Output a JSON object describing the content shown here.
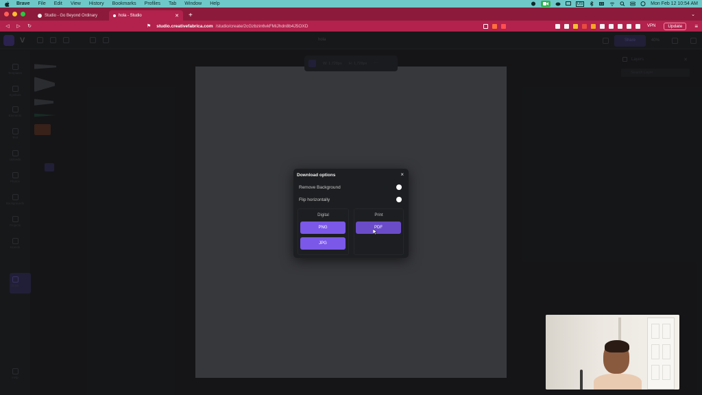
{
  "menubar": {
    "app": "Brave",
    "items": [
      "File",
      "Edit",
      "View",
      "History",
      "Bookmarks",
      "Profiles",
      "Tab",
      "Window",
      "Help"
    ],
    "input_source": "US",
    "clock": "Mon Feb 12  10:54 AM"
  },
  "tabs": [
    {
      "title": "Studio - Go Beyond Ordinary"
    },
    {
      "title": "hola - Studio"
    }
  ],
  "address": {
    "domain": "studio.creativefabrica.com",
    "path": "/studio/create/2cGzbzin6vkFMiJhdn8b4J5OXD",
    "vpn_label": "VPN",
    "update_label": "Update"
  },
  "app": {
    "doc_name": "hola",
    "share_label": "Share",
    "zoom_label": "40%",
    "size_w": "W: 1,728px",
    "size_h": "H: 1,728px",
    "rail": [
      "Templates",
      "Symbols",
      "Elements",
      "Text",
      "Uploads",
      "Photos",
      "Backgrounds",
      "Projects",
      "Brands",
      "Draw",
      "Help"
    ],
    "layers_title": "Layers",
    "layers_search": "Search Layer"
  },
  "modal": {
    "title": "Download options",
    "close": "×",
    "remove_bg": "Remove Background",
    "flip": "Flip horizontally",
    "digital_title": "Digital",
    "print_title": "Print",
    "png": "PNG",
    "jpg": "JPG",
    "pdf": "PDF"
  },
  "colors": {
    "accent": "#7b58e8",
    "browser_chrome": "#b2224c",
    "menubar": "#6fc8c8"
  }
}
